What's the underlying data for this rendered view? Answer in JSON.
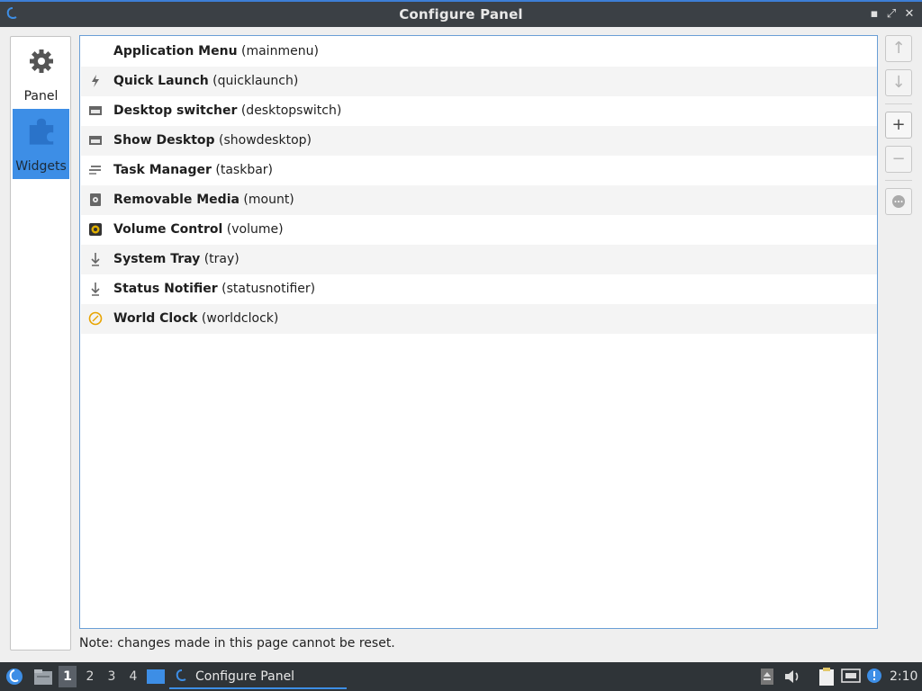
{
  "window": {
    "title": "Configure Panel",
    "controls": {
      "minimize": "▪",
      "maximize": "⤢",
      "close": "✕"
    }
  },
  "sidebar": {
    "items": [
      {
        "label": "Panel",
        "icon": "gear-icon"
      },
      {
        "label": "Widgets",
        "icon": "puzzle-icon",
        "selected": true
      }
    ]
  },
  "widgets": [
    {
      "name": "Application Menu",
      "id": "(mainmenu)",
      "icon": "blank-icon"
    },
    {
      "name": "Quick Launch",
      "id": "(quicklaunch)",
      "icon": "bolt-icon"
    },
    {
      "name": "Desktop switcher",
      "id": "(desktopswitch)",
      "icon": "window-icon"
    },
    {
      "name": "Show Desktop",
      "id": "(showdesktop)",
      "icon": "window-icon"
    },
    {
      "name": "Task Manager",
      "id": "(taskbar)",
      "icon": "taskbar-icon"
    },
    {
      "name": "Removable Media",
      "id": "(mount)",
      "icon": "drive-icon"
    },
    {
      "name": "Volume Control",
      "id": "(volume)",
      "icon": "speaker-icon"
    },
    {
      "name": "System Tray",
      "id": "(tray)",
      "icon": "tray-icon"
    },
    {
      "name": "Status Notifier",
      "id": "(statusnotifier)",
      "icon": "tray-icon"
    },
    {
      "name": "World Clock",
      "id": "(worldclock)",
      "icon": "clock-icon"
    }
  ],
  "buttons": {
    "move_up": "↑",
    "move_down": "↓",
    "add": "+",
    "remove": "−",
    "configure": "⋯"
  },
  "note": "Note: changes made in this page cannot be reset.",
  "taskbar": {
    "desktops": [
      "1",
      "2",
      "3",
      "4"
    ],
    "active_desktop": "1",
    "task_label": "Configure Panel",
    "clock": "2:10"
  },
  "colors": {
    "accent": "#3d8ee6",
    "titlebar": "#3b4045",
    "taskbar": "#2f3438"
  }
}
